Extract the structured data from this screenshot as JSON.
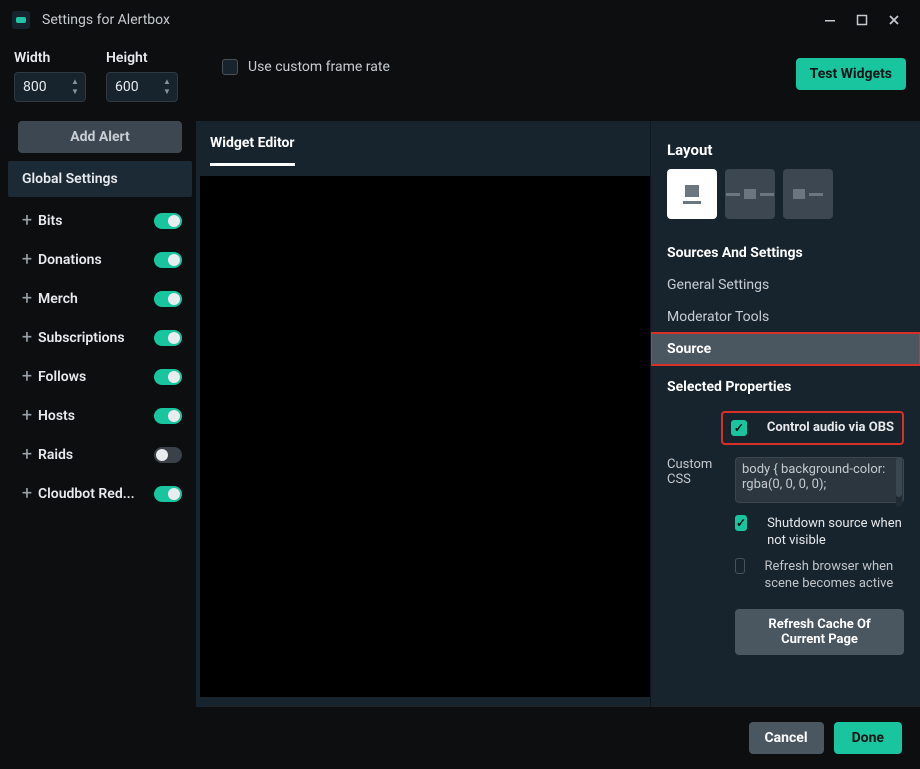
{
  "titlebar": {
    "title": "Settings for Alertbox"
  },
  "toolbar": {
    "width_label": "Width",
    "height_label": "Height",
    "width_value": "800",
    "height_value": "600",
    "custom_rate_label": "Use custom frame rate",
    "custom_rate_checked": false,
    "test_button": "Test Widgets"
  },
  "sidebar": {
    "add_alert": "Add Alert",
    "global_settings": "Global Settings",
    "items": [
      {
        "label": "Bits",
        "on": true
      },
      {
        "label": "Donations",
        "on": true
      },
      {
        "label": "Merch",
        "on": true
      },
      {
        "label": "Subscriptions",
        "on": true
      },
      {
        "label": "Follows",
        "on": true
      },
      {
        "label": "Hosts",
        "on": true
      },
      {
        "label": "Raids",
        "on": false
      },
      {
        "label": "Cloudbot Red...",
        "on": true
      }
    ]
  },
  "editor": {
    "tab": "Widget Editor"
  },
  "right": {
    "layout_title": "Layout",
    "sources_title": "Sources And Settings",
    "menu": {
      "general": "General Settings",
      "moderator": "Moderator Tools",
      "source": "Source"
    },
    "selected_title": "Selected Properties",
    "props": {
      "control_audio": "Control audio via OBS",
      "css_label": "Custom CSS",
      "css_value": "body { background-color: rgba(0, 0, 0, 0);",
      "shutdown": "Shutdown source when not visible",
      "refresh_browser": "Refresh browser when scene becomes active",
      "refresh_cache": "Refresh Cache Of Current Page"
    }
  },
  "footer": {
    "cancel": "Cancel",
    "done": "Done"
  }
}
